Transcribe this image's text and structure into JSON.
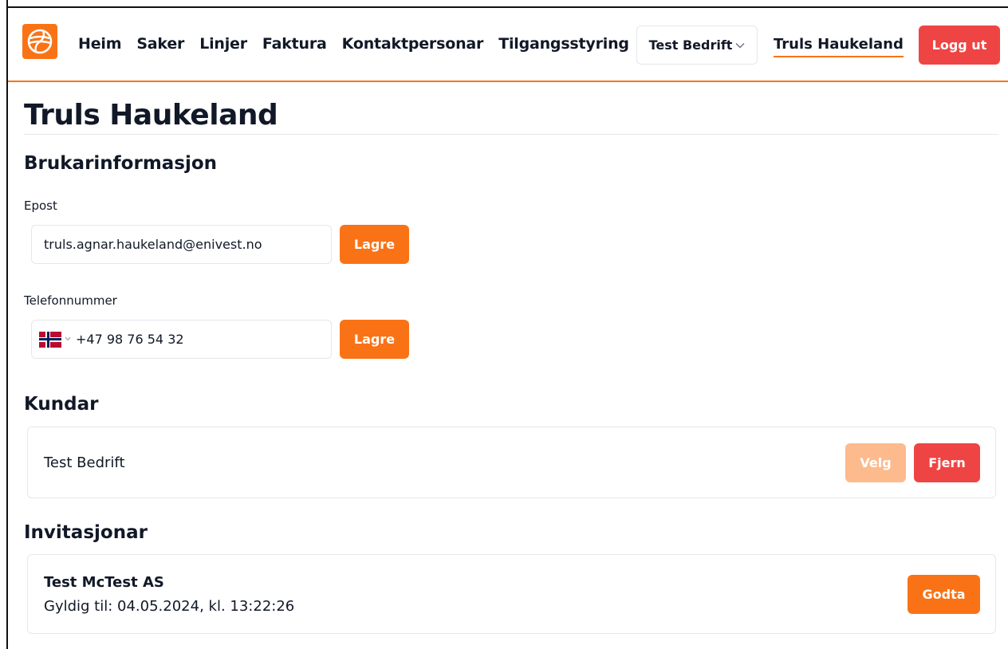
{
  "colors": {
    "accent": "#f97316",
    "danger": "#ef4444",
    "accent_disabled": "#fdba8c"
  },
  "header": {
    "logo_icon": "globe-icon",
    "nav": [
      "Heim",
      "Saker",
      "Linjer",
      "Faktura",
      "Kontaktpersonar",
      "Tilgangsstyring"
    ],
    "company_select": "Test Bedrift",
    "user_name": "Truls Haukeland",
    "logout_label": "Logg ut"
  },
  "main": {
    "page_title": "Truls Haukeland",
    "user_info": {
      "title": "Brukarinformasjon",
      "email_label": "Epost",
      "email_value": "truls.agnar.haukeland@enivest.no",
      "phone_label": "Telefonnummer",
      "phone_value": "+47 98 76 54 32",
      "phone_country_icon": "norway-flag-icon",
      "save_label": "Lagre"
    },
    "customers": {
      "title": "Kundar",
      "items": [
        {
          "name": "Test Bedrift",
          "select_label": "Velg",
          "remove_label": "Fjern"
        }
      ]
    },
    "invitations": {
      "title": "Invitasjonar",
      "items": [
        {
          "company": "Test McTest AS",
          "valid_until": "Gyldig til: 04.05.2024, kl. 13:22:26",
          "accept_label": "Godta"
        }
      ]
    }
  }
}
